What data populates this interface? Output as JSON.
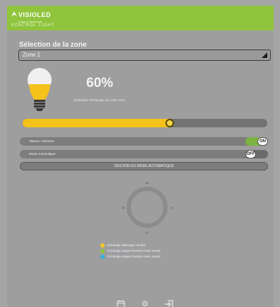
{
  "header": {
    "brand": "VISIOLED",
    "tagline": "lumière & technologie",
    "product": "KONTROL LIGHT"
  },
  "zone": {
    "section_title": "Sélection de la zone",
    "selected": "Zone 1"
  },
  "intensity": {
    "percent_text": "60%",
    "caption": "d'intensité d'éclairage sur cette zone",
    "level": 0.6
  },
  "toggles": [
    {
      "label": "Allumer / Eteindre",
      "state": "ON",
      "on": true
    },
    {
      "label": "Mode Automatique",
      "state": "OFF",
      "on": false
    }
  ],
  "auto_button_label": "GESTION DU MODE AUTOMATIQUE",
  "clock": {
    "label_top": "00",
    "label_right": "6",
    "label_bottom": "12",
    "label_left": "18"
  },
  "legend": [
    {
      "label": "Eclairage allumage continu",
      "color": "#f5c724"
    },
    {
      "label": "Eclairage plages horaires sans sonde",
      "color": "#8fc43c"
    },
    {
      "label": "Eclairage plages horaires avec sonde",
      "color": "#3bb0e0"
    }
  ],
  "colors": {
    "brand_green": "#8fc43c",
    "accent_yellow": "#f4c21b",
    "toggle_on": "#7cb342",
    "toggle_off": "#6a6a6a"
  },
  "footer_icons": [
    "calendar-icon",
    "gear-icon",
    "logout-icon"
  ]
}
